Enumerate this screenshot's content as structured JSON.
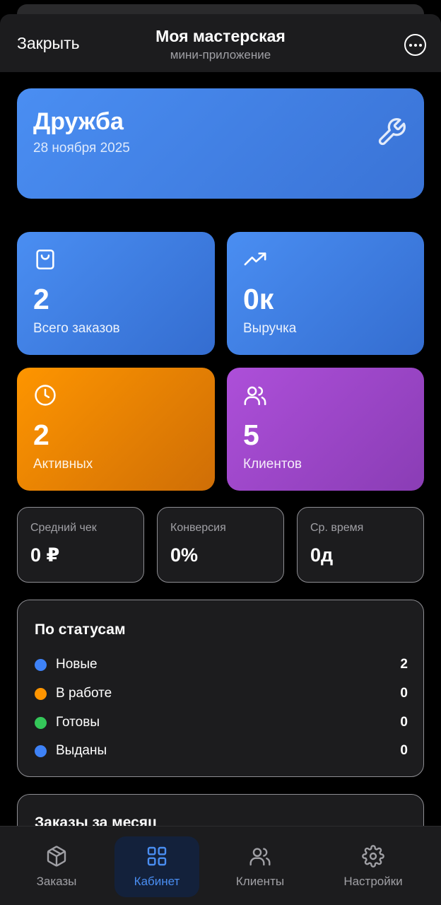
{
  "header": {
    "close_label": "Закрыть",
    "title": "Моя мастерская",
    "subtitle": "мини-приложение",
    "more_icon": "more-horizontal-icon"
  },
  "hero": {
    "title": "Дружба",
    "date": "28 ноября 2025",
    "icon": "wrench-icon"
  },
  "stats": [
    {
      "value": "2",
      "label": "Всего заказов",
      "icon": "shopping-bag-icon",
      "color": "#4a8ef2"
    },
    {
      "value": "0к",
      "label": "Выручка",
      "icon": "trending-up-icon",
      "color": "#4a8ef2"
    },
    {
      "value": "2",
      "label": "Активных",
      "icon": "clock-icon",
      "color": "#fe9500"
    },
    {
      "value": "5",
      "label": "Клиентов",
      "icon": "users-icon",
      "color": "#ad4fd9"
    }
  ],
  "metrics": [
    {
      "label": "Средний чек",
      "value": "0 ₽"
    },
    {
      "label": "Конверсия",
      "value": "0%"
    },
    {
      "label": "Ср. время",
      "value": "0д"
    }
  ],
  "statuses": {
    "title": "По статусам",
    "items": [
      {
        "name": "Новые",
        "count": "2",
        "color": "#3e82f7"
      },
      {
        "name": "В работе",
        "count": "0",
        "color": "#ff9500"
      },
      {
        "name": "Готовы",
        "count": "0",
        "color": "#34c759"
      },
      {
        "name": "Выданы",
        "count": "0",
        "color": "#3e82f7"
      }
    ]
  },
  "month": {
    "title": "Заказы за месяц"
  },
  "tabs": [
    {
      "label": "Заказы",
      "icon": "package-icon",
      "active": false
    },
    {
      "label": "Кабинет",
      "icon": "dashboard-grid-icon",
      "active": true
    },
    {
      "label": "Клиенты",
      "icon": "users-icon",
      "active": false
    },
    {
      "label": "Настройки",
      "icon": "gear-icon",
      "active": false
    }
  ]
}
